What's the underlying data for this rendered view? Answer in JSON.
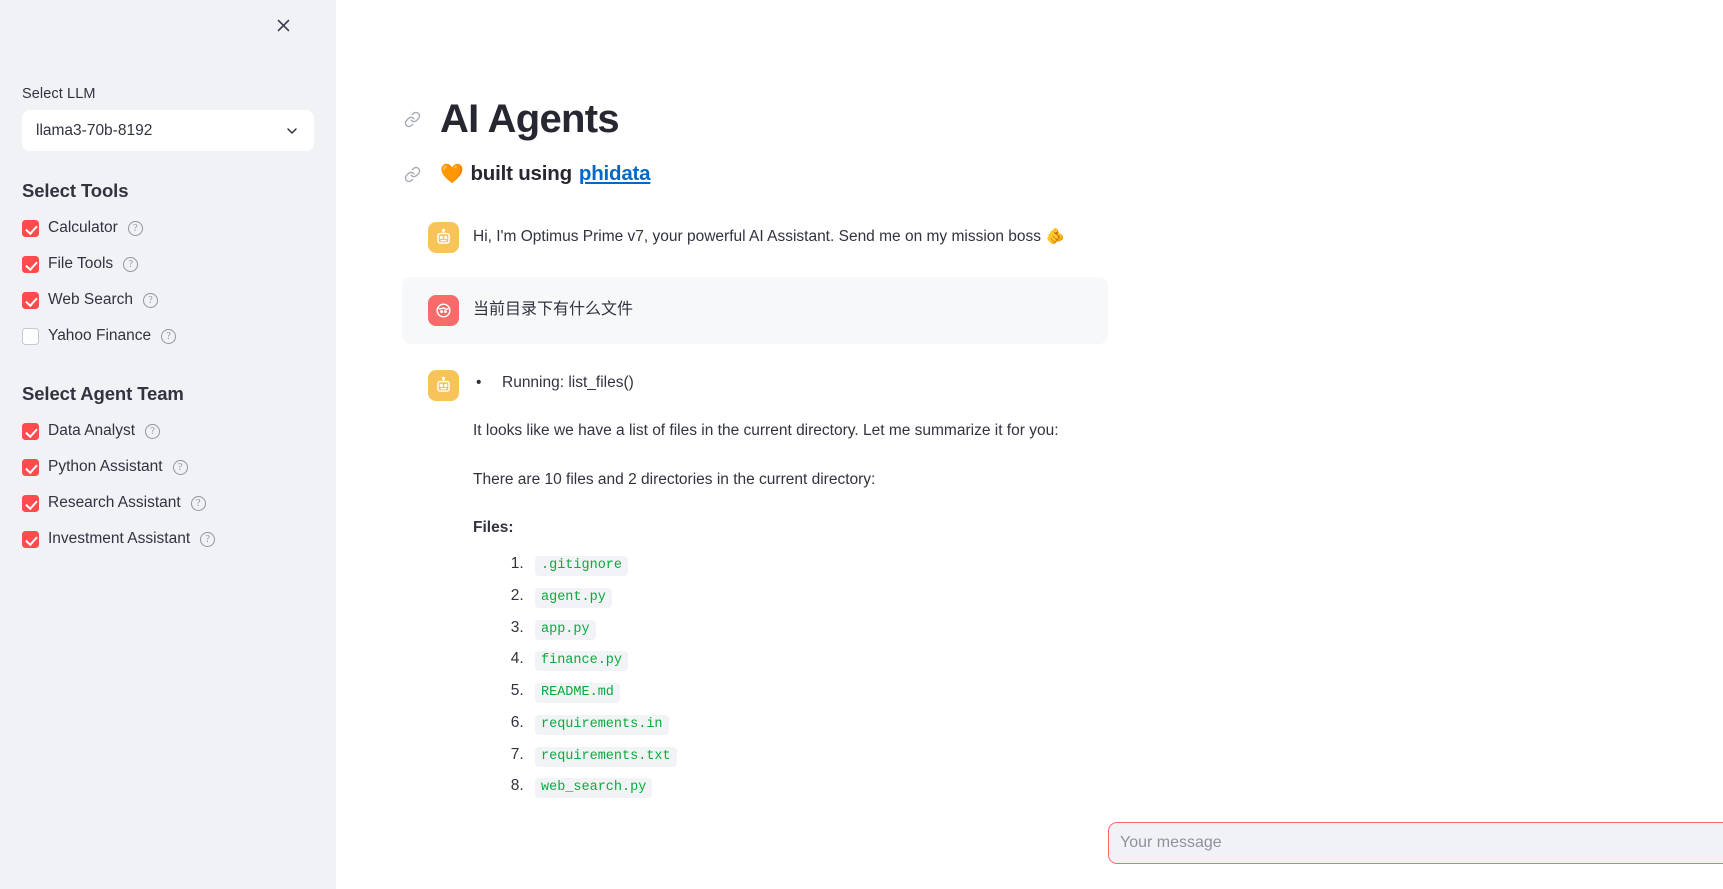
{
  "sidebar": {
    "close_icon": "close-icon",
    "llm": {
      "label": "Select LLM",
      "selected": "llama3-70b-8192"
    },
    "tools": {
      "heading": "Select Tools",
      "items": [
        {
          "label": "Calculator",
          "checked": true
        },
        {
          "label": "File Tools",
          "checked": true
        },
        {
          "label": "Web Search",
          "checked": true
        },
        {
          "label": "Yahoo Finance",
          "checked": false
        }
      ]
    },
    "agent_team": {
      "heading": "Select Agent Team",
      "items": [
        {
          "label": "Data Analyst",
          "checked": true
        },
        {
          "label": "Python Assistant",
          "checked": true
        },
        {
          "label": "Research Assistant",
          "checked": true
        },
        {
          "label": "Investment Assistant",
          "checked": true
        }
      ]
    },
    "help_glyph": "?"
  },
  "main": {
    "title": "AI Agents",
    "subtitle": {
      "heart": "🧡",
      "text": "built using",
      "link": "phidata"
    },
    "anchor_icon": "link-icon",
    "chat": {
      "greeting": {
        "role": "assistant",
        "avatar": "robot-icon",
        "text": "Hi, I'm Optimus Prime v7, your powerful AI Assistant. Send me on my mission boss",
        "emoji": "🫵"
      },
      "user_message": {
        "role": "user",
        "avatar": "person-icon",
        "text": "当前目录下有什么文件"
      },
      "response": {
        "role": "assistant",
        "avatar": "robot-icon",
        "tool_calls": [
          "Running: list_files()"
        ],
        "paragraphs": [
          "It looks like we have a list of files in the current directory. Let me summarize it for you:",
          "There are 10 files and 2 directories in the current directory:"
        ],
        "files_heading": "Files:",
        "files": [
          ".gitignore",
          "agent.py",
          "app.py",
          "finance.py",
          "README.md",
          "requirements.in",
          "requirements.txt",
          "web_search.py"
        ]
      }
    },
    "input": {
      "value": "",
      "placeholder": "Your message",
      "send_icon": "send-icon"
    }
  },
  "colors": {
    "sidebar_bg": "#f0f2f6",
    "accent_red": "#ff4b4b",
    "link_blue": "#0068c9",
    "code_green": "#09ab3b",
    "bot_avatar": "#f8c45a",
    "user_avatar": "#f96a6a",
    "input_border": "#ff6b6b"
  }
}
